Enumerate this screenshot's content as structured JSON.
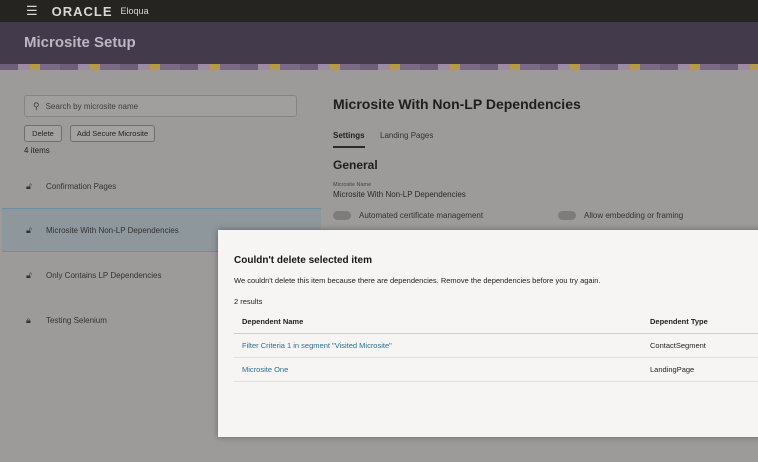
{
  "topbar": {
    "brand": "ORACLE",
    "product": "Eloqua"
  },
  "header": {
    "title": "Microsite Setup"
  },
  "sidebar": {
    "search_placeholder": "Search by microsite name",
    "delete_label": "Delete",
    "add_label": "Add Secure Microsite",
    "count": "4 items",
    "items": [
      {
        "label": "Confirmation Pages",
        "icon": "unlock-icon"
      },
      {
        "label": "Microsite With Non-LP Dependencies",
        "icon": "unlock-icon",
        "selected": true
      },
      {
        "label": "Only Contains LP Dependencies",
        "icon": "unlock-icon"
      },
      {
        "label": "Testing Selenium",
        "icon": "lock-icon"
      }
    ]
  },
  "detail": {
    "title": "Microsite With Non-LP Dependencies",
    "tabs": [
      "Settings",
      "Landing Pages"
    ],
    "section": "General",
    "name_label": "Microsite Name",
    "name_value": "Microsite With Non-LP Dependencies",
    "toggle1": "Automated certificate management",
    "toggle2": "Allow embedding or framing"
  },
  "dialog": {
    "title": "Couldn't delete selected item",
    "message": "We couldn't delete this item because there are dependencies. Remove the dependencies before you try again.",
    "results": "2 results",
    "columns": [
      "Dependent Name",
      "Dependent Type"
    ],
    "rows": [
      {
        "name": "Filter Criteria 1 in segment \"Visited Microsite\"",
        "type": "ContactSegment"
      },
      {
        "name": "Microsite One",
        "type": "LandingPage"
      }
    ]
  }
}
